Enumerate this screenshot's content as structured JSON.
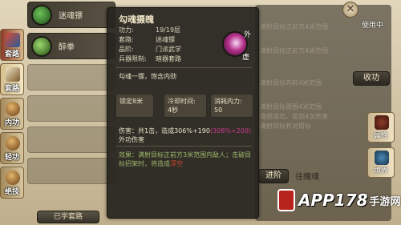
{
  "left_tabs": [
    {
      "label": "套路",
      "icon": "book-icon"
    },
    {
      "label": "套路",
      "icon": "scroll-icon"
    },
    {
      "label": "内功",
      "icon": "meditation-icon"
    },
    {
      "label": "轻功",
      "icon": "runner-icon"
    },
    {
      "label": "绝技",
      "icon": "fighter-icon"
    }
  ],
  "skill_list": [
    {
      "name": "迷魂镖"
    },
    {
      "name": "醉拳"
    }
  ],
  "learned_button": "已学套路",
  "right_panel": {
    "partial_lines": [
      "命中",
      "满射目标正前方4米范围",
      "满射目标正前方4米范围",
      "满射目标向前4米范围",
      "满射目标周围4米范围",
      "造成成功，追加4次伤害",
      "满射目标并对目标"
    ],
    "badge": "使用中",
    "level_up": "收功",
    "advance": "进阶",
    "skill_label": "往魄魂",
    "tabs": [
      {
        "label": "属性"
      },
      {
        "label": "境界"
      }
    ]
  },
  "tooltip": {
    "title": "勾魂摄魄",
    "icon_tag_outer": "外",
    "icon_tag_inner": "虚",
    "rows": [
      {
        "key": "功力:",
        "value": "19/19层"
      },
      {
        "key": "套路:",
        "value": "迷魂镖"
      },
      {
        "key": "品阶:",
        "value": "门派武学"
      },
      {
        "key": "兵器限制:",
        "value": "暗器套路"
      }
    ],
    "summary": "勾魂一镖，饱含内劲",
    "cells": [
      {
        "key": "锁定8米",
        "value": ""
      },
      {
        "key": "冷却时间:",
        "value": "4秒"
      },
      {
        "key": "消耗内力:",
        "value": "50"
      }
    ],
    "damage_prefix": "伤害：共1击，造成306%+190",
    "damage_pink": "(308%+200)",
    "damage_suffix": "外功伤害",
    "effect_prefix": "效果：满射目标正前方3米范围内敌人；击破目标招架时，将造成",
    "effect_red": "浮空"
  },
  "close_icon": "close-icon",
  "watermark": {
    "logo": "APP178",
    "sub": "手游网"
  }
}
